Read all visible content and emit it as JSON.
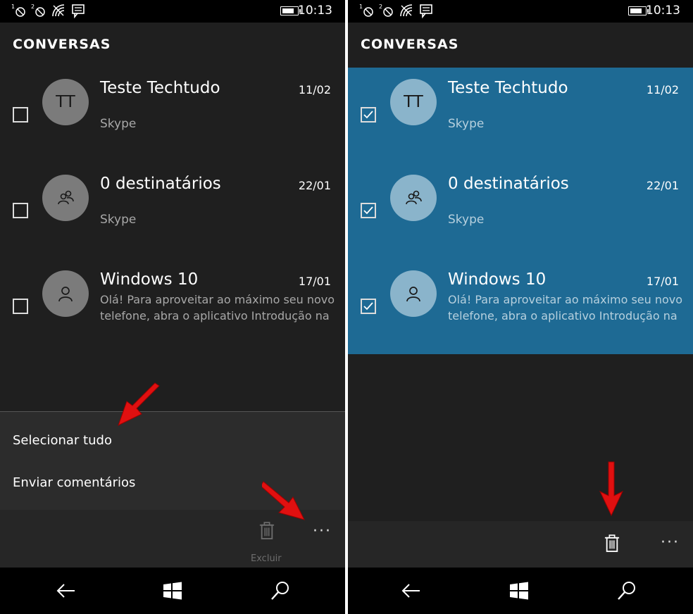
{
  "colors": {
    "accent": "#1e6a94",
    "background": "#1f1f1f",
    "arrow": "#e01010"
  },
  "status": {
    "time": "10:13",
    "battery_level": 0.8,
    "icons": [
      "sim1-no-signal-icon",
      "sim2-no-signal-icon",
      "wifi-icon",
      "message-icon"
    ]
  },
  "left": {
    "title": "CONVERSAS",
    "conversations": [
      {
        "avatar": "TT",
        "name": "Teste Techtudo",
        "date": "11/02",
        "sub": "Skype",
        "checked": false
      },
      {
        "avatar": "group-icon",
        "name": "0 destinatários",
        "date": "22/01",
        "sub": "Skype",
        "checked": false
      },
      {
        "avatar": "person-icon",
        "name": "Windows 10",
        "date": "17/01",
        "message": "Olá! Para aproveitar ao máximo seu novo telefone, abra o aplicativo Introdução na",
        "checked": false
      }
    ],
    "menu": {
      "select_all": "Selecionar tudo",
      "send_feedback": "Enviar comentários"
    },
    "appbar": {
      "delete_label": "Excluir",
      "more": "···"
    }
  },
  "right": {
    "title": "CONVERSAS",
    "conversations": [
      {
        "avatar": "TT",
        "name": "Teste Techtudo",
        "date": "11/02",
        "sub": "Skype",
        "checked": true
      },
      {
        "avatar": "group-icon",
        "name": "0 destinatários",
        "date": "22/01",
        "sub": "Skype",
        "checked": true
      },
      {
        "avatar": "person-icon",
        "name": "Windows 10",
        "date": "17/01",
        "message": "Olá! Para aproveitar ao máximo seu novo telefone, abra o aplicativo Introdução na",
        "checked": true
      }
    ],
    "appbar": {
      "more": "···"
    }
  },
  "navbar": {
    "icons": [
      "back-icon",
      "windows-start-icon",
      "search-icon"
    ]
  }
}
